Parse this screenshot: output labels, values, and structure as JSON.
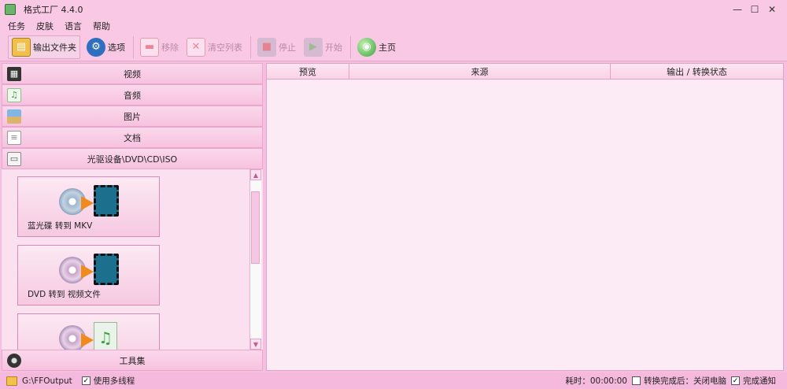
{
  "window": {
    "title": "格式工厂 4.4.0",
    "controls": {
      "minimize": "—",
      "maximize": "☐",
      "close": "✕"
    }
  },
  "menu": [
    "任务",
    "皮肤",
    "语言",
    "帮助"
  ],
  "toolbar": {
    "output_folder": "输出文件夹",
    "options": "选项",
    "remove": "移除",
    "clear_list": "清空列表",
    "stop": "停止",
    "start": "开始",
    "home": "主页"
  },
  "categories": [
    {
      "label": "视频",
      "icon": "video-icon"
    },
    {
      "label": "音频",
      "icon": "audio-icon"
    },
    {
      "label": "图片",
      "icon": "picture-icon"
    },
    {
      "label": "文档",
      "icon": "document-icon"
    },
    {
      "label": "光驱设备\\DVD\\CD\\ISO",
      "icon": "optical-drive-icon"
    }
  ],
  "tasks": [
    {
      "label": "蓝光碟 转到 MKV",
      "icon": "bluray-to-video-icon"
    },
    {
      "label": "DVD 转到 视频文件",
      "icon": "dvd-to-video-icon"
    },
    {
      "label": "",
      "icon": "cd-to-audio-icon"
    }
  ],
  "tools_label": "工具集",
  "grid": {
    "columns": [
      "预览",
      "来源",
      "输出 / 转换状态"
    ]
  },
  "status": {
    "output_path": "G:\\FFOutput",
    "multithread_label": "使用多线程",
    "multithread_checked": "✓",
    "elapsed_label": "耗时：00:00:00",
    "after_convert_label": "转换完成后：关闭电脑",
    "after_convert_checked": "",
    "notify_label": "完成通知",
    "notify_checked": "✓"
  },
  "colors": {
    "skin": "#f7c6e2",
    "accent": "#e4a2c7"
  }
}
